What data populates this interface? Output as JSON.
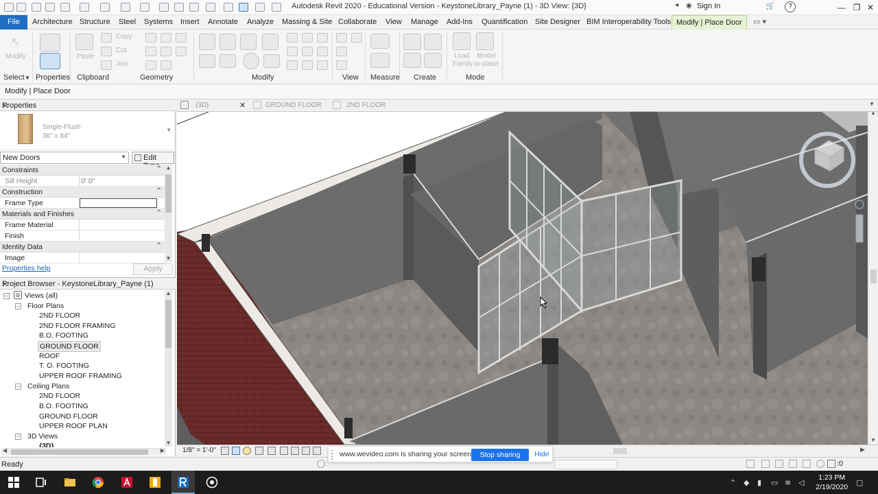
{
  "window": {
    "title": "Autodesk Revit 2020 - Educational Version - KeystoneLibrary_Payne (1) - 3D View: {3D}",
    "sign_in": "Sign In"
  },
  "ribbon_tabs": [
    "File",
    "Architecture",
    "Structure",
    "Steel",
    "Systems",
    "Insert",
    "Annotate",
    "Analyze",
    "Massing & Site",
    "Collaborate",
    "View",
    "Manage",
    "Add-Ins",
    "Quantification",
    "Site Designer",
    "BIM Interoperability Tools",
    "Modify | Place Door"
  ],
  "ribbon": {
    "modify_label": "Modify",
    "clipboard": {
      "paste": "Paste",
      "copy": "Copy",
      "cut": "Cut",
      "join": "Join"
    },
    "create": {
      "load_family": "Load Family",
      "model_inplace": "Model In-place"
    },
    "panels": {
      "select": "Select",
      "properties": "Properties",
      "clipboard": "Clipboard",
      "geometry": "Geometry",
      "modify": "Modify",
      "view": "View",
      "measure": "Measure",
      "create": "Create",
      "mode": "Mode"
    }
  },
  "options_bar": {
    "context": "Modify | Place Door"
  },
  "properties": {
    "title": "Properties",
    "type_name": "Single-Flush",
    "type_size": "36\" x 84\"",
    "instance_selector": "New Doors",
    "edit_type": "Edit Type",
    "groups": {
      "constraints": "Constraints",
      "sill_height_label": "Sill Height",
      "sill_height_value": "0' 0\"",
      "construction": "Construction",
      "frame_type_label": "Frame Type",
      "materials": "Materials and Finishes",
      "frame_material_label": "Frame Material",
      "finish_label": "Finish",
      "identity": "Identity Data",
      "image_label": "Image"
    },
    "help_link": "Properties help",
    "apply": "Apply"
  },
  "project_browser": {
    "title": "Project Browser - KeystoneLibrary_Payne (1)",
    "root": "Views (all)",
    "floor_plans_label": "Floor Plans",
    "floor_plans": [
      "2ND FLOOR",
      "2ND FLOOR FRAMING",
      "B.O. FOOTING",
      "GROUND FLOOR",
      "ROOF",
      "T. O. FOOTING",
      "UPPER ROOF FRAMING"
    ],
    "ceiling_plans_label": "Ceiling Plans",
    "ceiling_plans": [
      "2ND FLOOR",
      "B.O. FOOTING",
      "GROUND FLOOR",
      "UPPER ROOF PLAN"
    ],
    "views_3d_label": "3D Views",
    "views_3d": [
      "{3D}"
    ]
  },
  "view_tabs": [
    "{3D}",
    "GROUND FLOOR",
    "2ND FLOOR"
  ],
  "view_control": {
    "scale": "1/8\" = 1'-0\""
  },
  "status": {
    "text": "Ready",
    "right_value": ":0"
  },
  "screen_share": {
    "message": "www.wevideo.com is sharing your screen.",
    "stop": "Stop sharing",
    "hide": "Hide"
  },
  "taskbar": {
    "time": "1:23 PM",
    "date": "2/19/2020"
  },
  "colors": {
    "file_tab": "#1e6fc4",
    "context_tab": "#e6f2d3",
    "share_button": "#1a73e8"
  }
}
